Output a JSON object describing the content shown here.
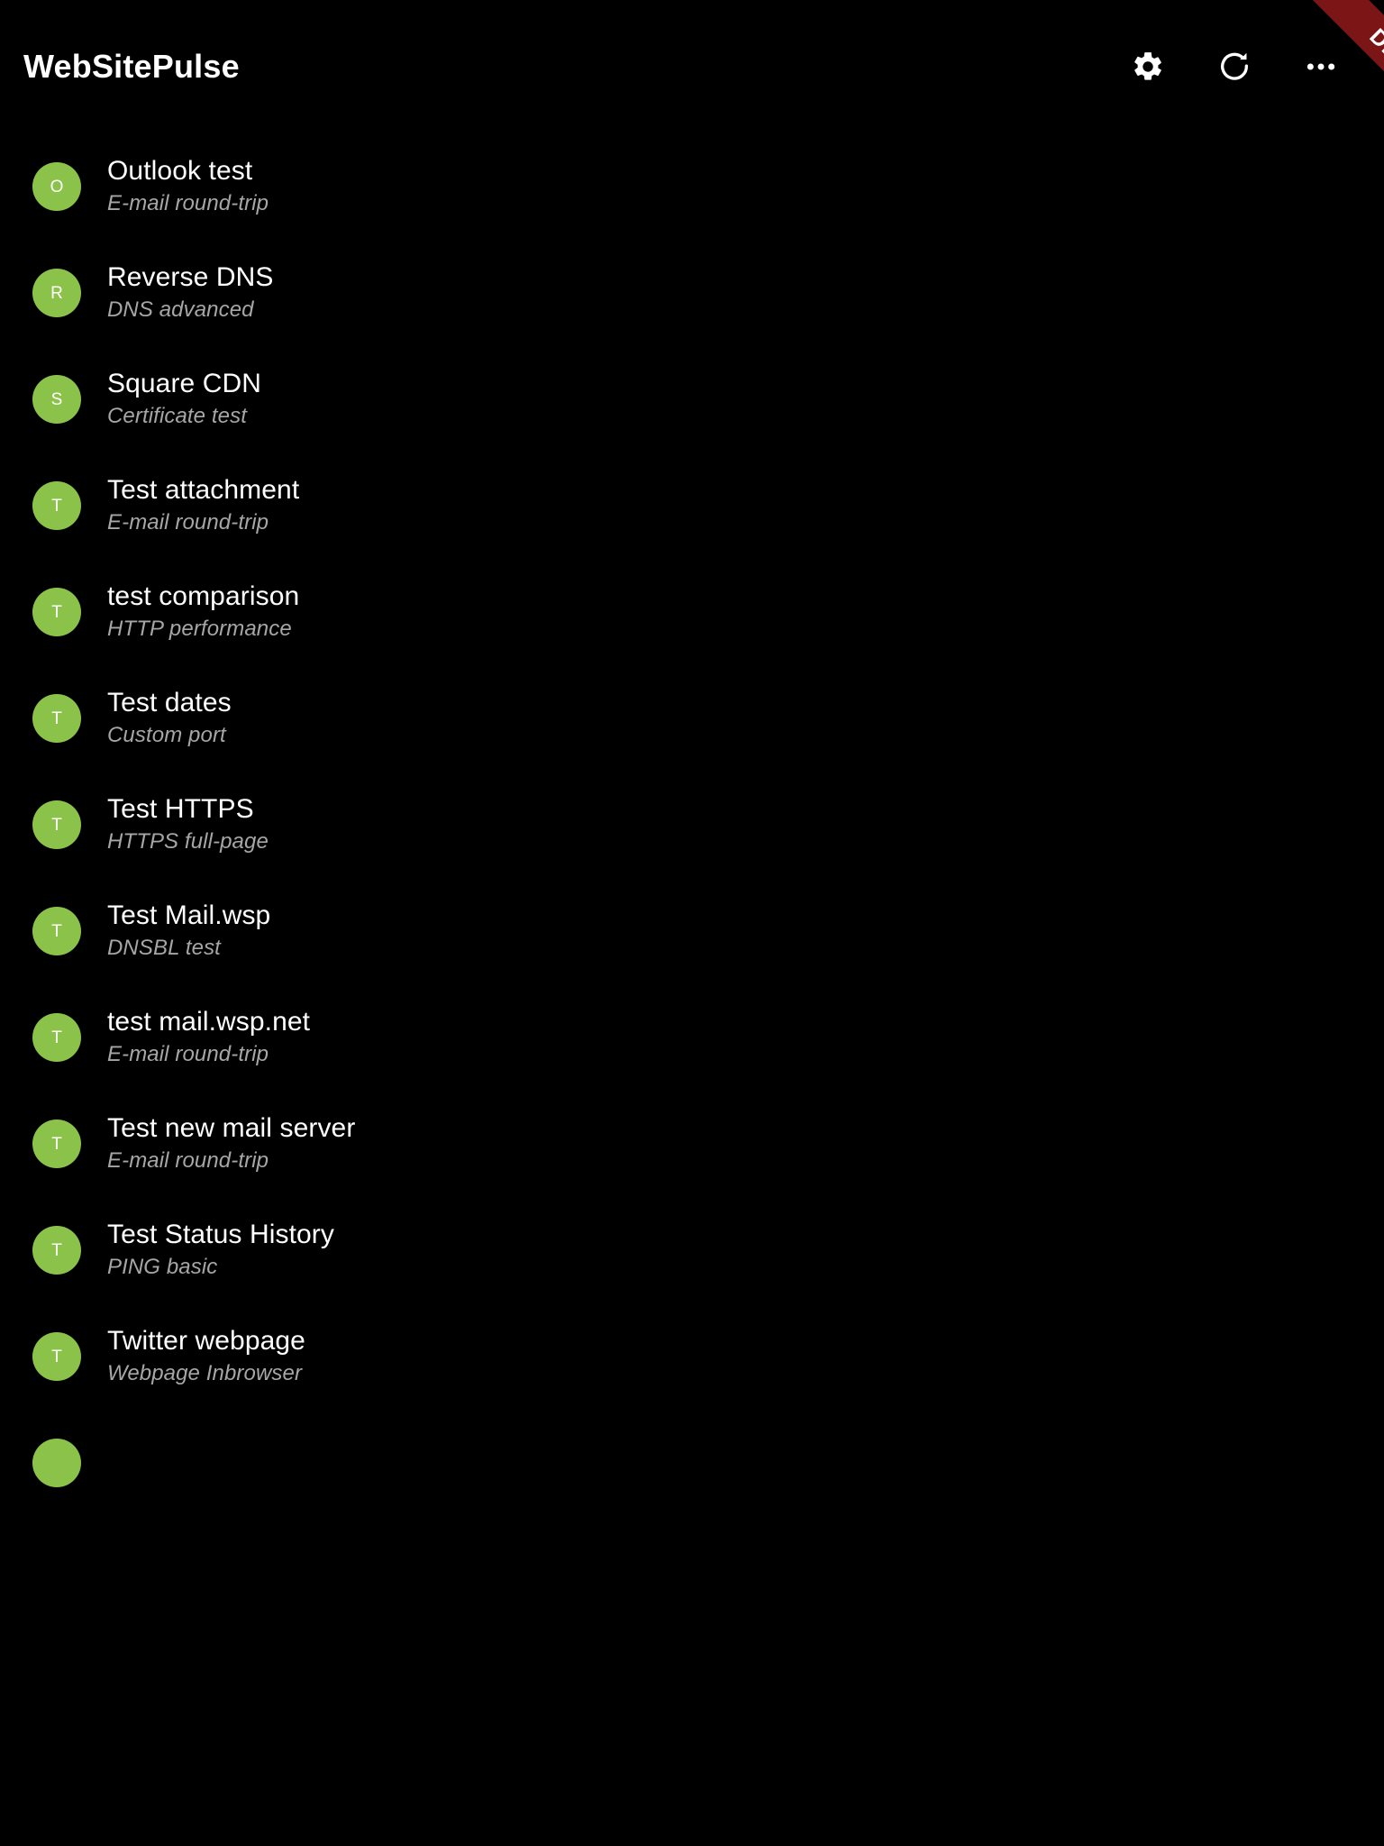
{
  "app": {
    "title": "WebSitePulse",
    "theme": {
      "background": "#000000",
      "avatar_green": "#8BC34A",
      "title_color": "#FFFFFF",
      "subtitle_color": "#A6A6A6",
      "debug_ribbon_red": "#7C1515"
    }
  },
  "appbar": {
    "title": "WebSitePulse",
    "actions": [
      {
        "name": "settings",
        "icon": "gear-icon",
        "label": "Settings"
      },
      {
        "name": "refresh",
        "icon": "refresh-icon",
        "label": "Refresh"
      },
      {
        "name": "overflow",
        "icon": "more-horizontal-icon",
        "label": "More options"
      }
    ],
    "debug_banner": "DEBUG"
  },
  "list": {
    "items": [
      {
        "initial": "O",
        "title": "Outlook test",
        "subtitle": "E-mail round-trip",
        "color": "#8BC34A"
      },
      {
        "initial": "R",
        "title": "Reverse DNS",
        "subtitle": "DNS advanced",
        "color": "#8BC34A"
      },
      {
        "initial": "S",
        "title": "Square CDN",
        "subtitle": "Certificate test",
        "color": "#8BC34A"
      },
      {
        "initial": "T",
        "title": "Test attachment",
        "subtitle": "E-mail round-trip",
        "color": "#8BC34A"
      },
      {
        "initial": "T",
        "title": "test comparison",
        "subtitle": "HTTP performance",
        "color": "#8BC34A"
      },
      {
        "initial": "T",
        "title": "Test dates",
        "subtitle": "Custom port",
        "color": "#8BC34A"
      },
      {
        "initial": "T",
        "title": "Test HTTPS",
        "subtitle": "HTTPS full-page",
        "color": "#8BC34A"
      },
      {
        "initial": "T",
        "title": "Test Mail.wsp",
        "subtitle": "DNSBL test",
        "color": "#8BC34A"
      },
      {
        "initial": "T",
        "title": "test mail.wsp.net",
        "subtitle": "E-mail round-trip",
        "color": "#8BC34A"
      },
      {
        "initial": "T",
        "title": "Test new mail server",
        "subtitle": "E-mail round-trip",
        "color": "#8BC34A"
      },
      {
        "initial": "T",
        "title": "Test Status History",
        "subtitle": "PING basic",
        "color": "#8BC34A"
      },
      {
        "initial": "T",
        "title": "Twitter webpage",
        "subtitle": "Webpage Inbrowser",
        "color": "#8BC34A"
      },
      {
        "initial": "",
        "title": "",
        "subtitle": "",
        "color": "#8BC34A"
      }
    ]
  }
}
